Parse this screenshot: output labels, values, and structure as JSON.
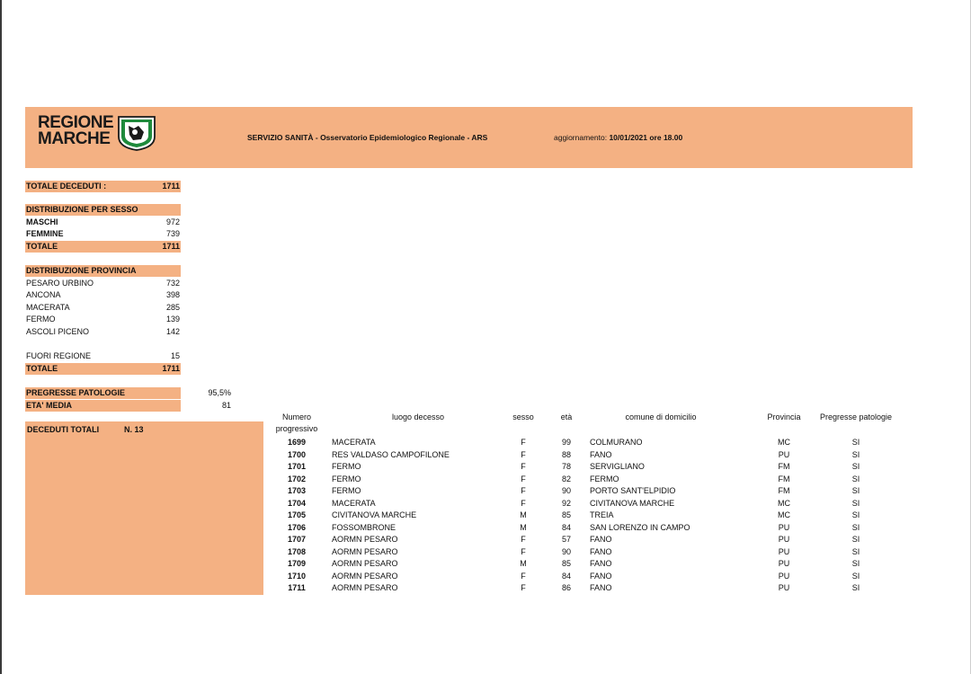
{
  "header": {
    "logo_line1": "REGIONE",
    "logo_line2": "MARCHE",
    "service": "SERVIZIO SANITÀ - Osservatorio Epidemiologico Regionale - ARS",
    "update_label": "aggiornamento:",
    "update_value": "10/01/2021 ore 18.00"
  },
  "totale_deceduti": {
    "label": "TOTALE DECEDUTI :",
    "value": "1711"
  },
  "sesso": {
    "title": "DISTRIBUZIONE PER SESSO",
    "rows": [
      {
        "label": "MASCHI",
        "value": "972"
      },
      {
        "label": "FEMMINE",
        "value": "739"
      }
    ],
    "total_label": "TOTALE",
    "total_value": "1711"
  },
  "provincia": {
    "title": "DISTRIBUZIONE  PROVINCIA",
    "rows": [
      {
        "label": "PESARO URBINO",
        "value": "732"
      },
      {
        "label": "ANCONA",
        "value": "398"
      },
      {
        "label": "MACERATA",
        "value": "285"
      },
      {
        "label": "FERMO",
        "value": "139"
      },
      {
        "label": "ASCOLI PICENO",
        "value": "142"
      }
    ],
    "fuori_label": "FUORI REGIONE",
    "fuori_value": "15",
    "total_label": "TOTALE",
    "total_value": "1711"
  },
  "patologie": {
    "label": "PREGRESSE PATOLOGIE",
    "value": "95,5%"
  },
  "eta_media": {
    "label": "ETA' MEDIA",
    "value": "81"
  },
  "deceduti_totali": {
    "label": "DECEDUTI TOTALI",
    "value": "N.  13"
  },
  "table": {
    "headers": {
      "num_1": "Numero",
      "num_2": "progressivo",
      "place": "luogo decesso",
      "sex": "sesso",
      "age": "età",
      "town": "comune di domicilio",
      "prov": "Provincia",
      "pat": "Pregresse patologie"
    },
    "rows": [
      {
        "num": "1699",
        "place": "MACERATA",
        "sex": "F",
        "age": "99",
        "town": "COLMURANO",
        "prov": "MC",
        "pat": "SI"
      },
      {
        "num": "1700",
        "place": "RES VALDASO CAMPOFILONE",
        "sex": "F",
        "age": "88",
        "town": "FANO",
        "prov": "PU",
        "pat": "SI"
      },
      {
        "num": "1701",
        "place": "FERMO",
        "sex": "F",
        "age": "78",
        "town": "SERVIGLIANO",
        "prov": "FM",
        "pat": "SI"
      },
      {
        "num": "1702",
        "place": "FERMO",
        "sex": "F",
        "age": "82",
        "town": "FERMO",
        "prov": "FM",
        "pat": "SI"
      },
      {
        "num": "1703",
        "place": "FERMO",
        "sex": "F",
        "age": "90",
        "town": "PORTO SANT'ELPIDIO",
        "prov": "FM",
        "pat": "SI"
      },
      {
        "num": "1704",
        "place": "MACERATA",
        "sex": "F",
        "age": "92",
        "town": "CIVITANOVA MARCHE",
        "prov": "MC",
        "pat": "SI"
      },
      {
        "num": "1705",
        "place": "CIVITANOVA MARCHE",
        "sex": "M",
        "age": "85",
        "town": "TREIA",
        "prov": "MC",
        "pat": "SI"
      },
      {
        "num": "1706",
        "place": "FOSSOMBRONE",
        "sex": "M",
        "age": "84",
        "town": "SAN LORENZO IN CAMPO",
        "prov": "PU",
        "pat": "SI"
      },
      {
        "num": "1707",
        "place": "AORMN PESARO",
        "sex": "F",
        "age": "57",
        "town": "FANO",
        "prov": "PU",
        "pat": "SI"
      },
      {
        "num": "1708",
        "place": "AORMN PESARO",
        "sex": "F",
        "age": "90",
        "town": "FANO",
        "prov": "PU",
        "pat": "SI"
      },
      {
        "num": "1709",
        "place": "AORMN PESARO",
        "sex": "M",
        "age": "85",
        "town": "FANO",
        "prov": "PU",
        "pat": "SI"
      },
      {
        "num": "1710",
        "place": "AORMN PESARO",
        "sex": "F",
        "age": "84",
        "town": "FANO",
        "prov": "PU",
        "pat": "SI"
      },
      {
        "num": "1711",
        "place": "AORMN PESARO",
        "sex": "F",
        "age": "86",
        "town": "FANO",
        "prov": "PU",
        "pat": "SI"
      }
    ]
  },
  "colors": {
    "band": "#f4b183",
    "logo_green": "#1f8a3c"
  }
}
